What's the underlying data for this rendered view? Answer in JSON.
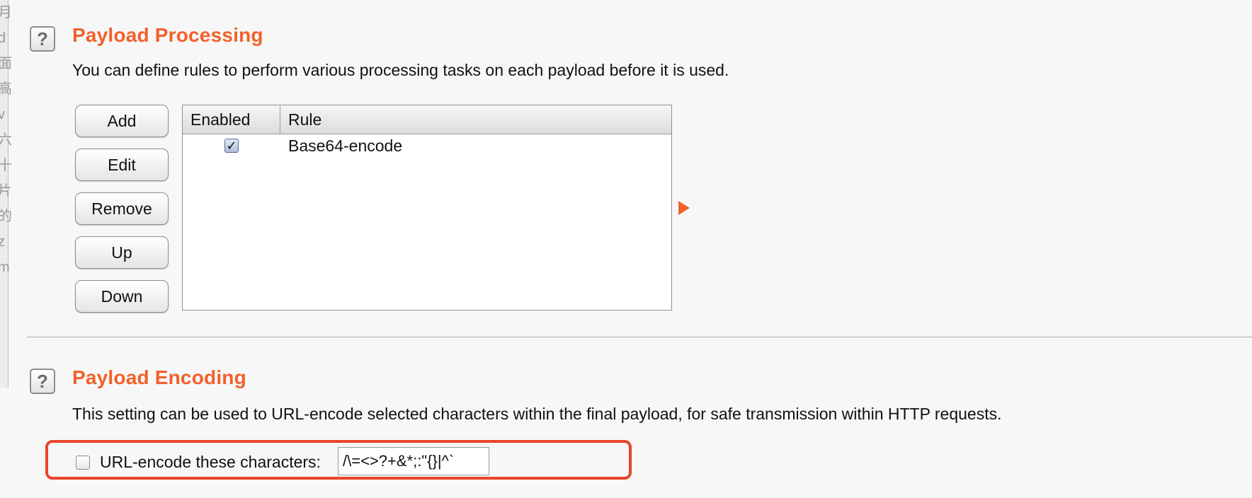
{
  "sidebar_fragments": [
    "月",
    "d",
    "面",
    "高",
    "v",
    "六",
    "十",
    "片",
    "的",
    "z",
    "m"
  ],
  "processing": {
    "help_icon": "help-question-icon",
    "help_symbol": "?",
    "title": "Payload Processing",
    "description": "You can define rules to perform various processing tasks on each payload before it is used.",
    "buttons": {
      "add": "Add",
      "edit": "Edit",
      "remove": "Remove",
      "up": "Up",
      "down": "Down"
    },
    "table": {
      "col_enabled": "Enabled",
      "col_rule": "Rule",
      "rows": [
        {
          "enabled": true,
          "check_symbol": "✓",
          "rule": "Base64-encode"
        }
      ]
    }
  },
  "encoding": {
    "help_icon": "help-question-icon",
    "help_symbol": "?",
    "title": "Payload Encoding",
    "description": "This setting can be used to URL-encode selected characters within the final payload, for safe transmission within HTTP requests.",
    "checkbox_checked": false,
    "checkbox_label": "URL-encode these characters:",
    "characters_value": "/\\=<>?+&*;:\"{}|^`"
  },
  "colors": {
    "accent": "#f2612b",
    "highlight_border": "#e8462a"
  }
}
